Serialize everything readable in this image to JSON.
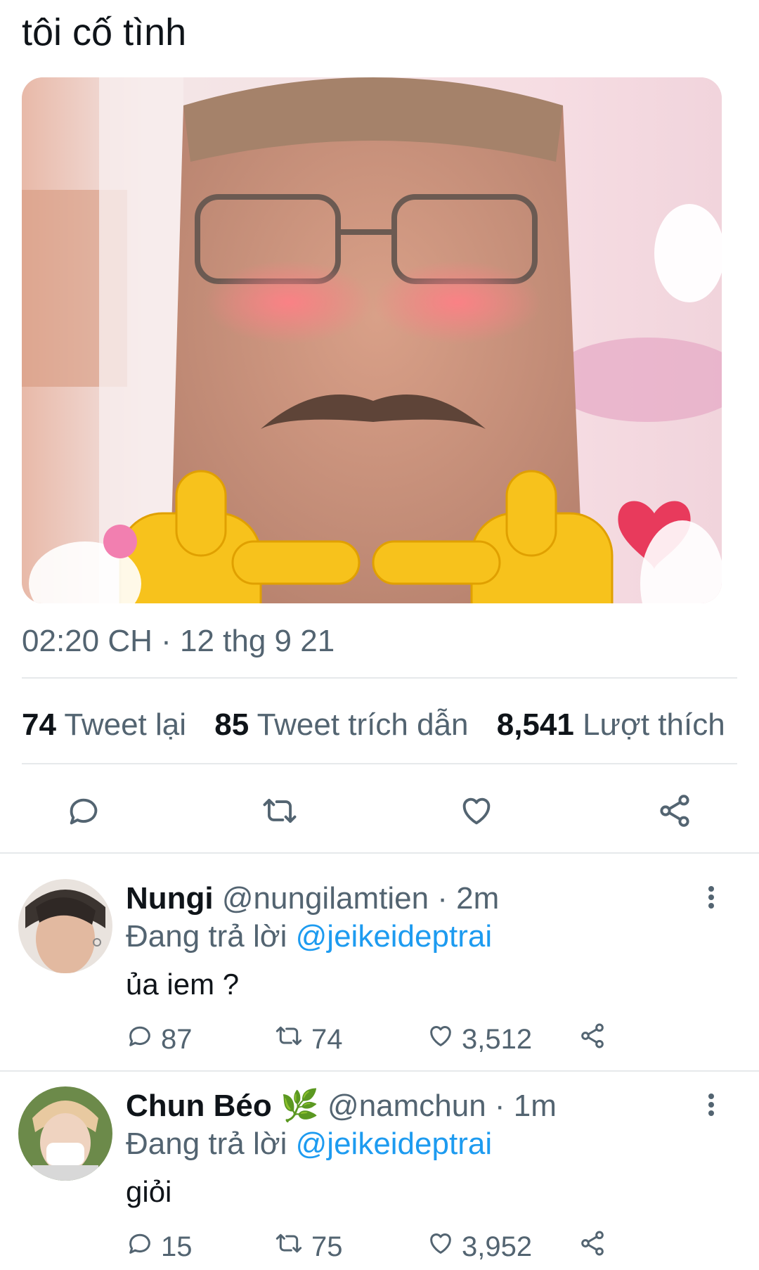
{
  "tweet": {
    "text": "tôi cố tình",
    "timestamp": "02:20 CH · 12 thg 9 21"
  },
  "stats": {
    "retweets_count": "74",
    "retweets_label": "Tweet lại",
    "quotes_count": "85",
    "quotes_label": "Tweet trích dẫn",
    "likes_count": "8,541",
    "likes_label": "Lượt thích"
  },
  "actions": {
    "icons": [
      "reply-icon",
      "retweet-icon",
      "like-icon",
      "share-icon"
    ]
  },
  "replies": [
    {
      "name": "Nungi",
      "handle": "@nungilamtien · 2m",
      "replying_prefix": "Đang trả lời",
      "replying_to": "@jeikeideptrai",
      "text": "ủa iem ?",
      "reply_count": "87",
      "retweet_count": "74",
      "like_count": "3,512"
    },
    {
      "name": "Chun Béo",
      "name_emoji": "🌿",
      "handle": "@namchun · 1m",
      "replying_prefix": "Đang trả lời",
      "replying_to": "@jeikeideptrai",
      "text": "giỏi",
      "reply_count": "15",
      "retweet_count": "75",
      "like_count": "3,952"
    }
  ],
  "colors": {
    "text": "#0f1419",
    "secondary": "#536471",
    "link": "#1d9bf0",
    "divider": "#e6e9eb"
  }
}
